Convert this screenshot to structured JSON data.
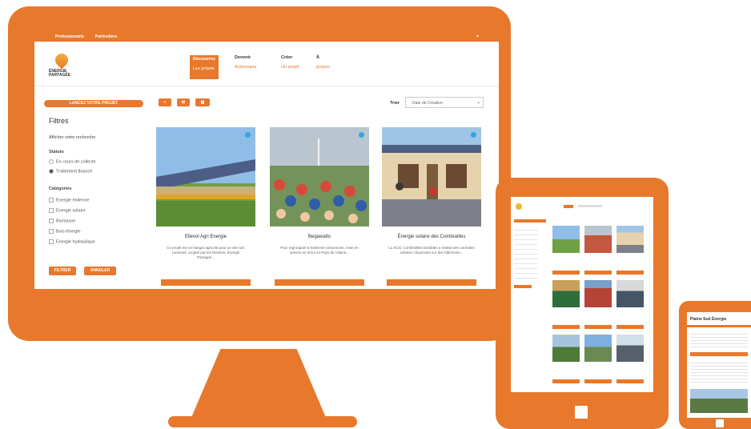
{
  "desktop": {
    "topbar": {
      "left_link_1": "Professionnels",
      "left_link_2": "Particuliers",
      "right_icon": "×"
    },
    "logo": {
      "line1": "ÉNERGIE",
      "line2": "PARTAGÉE"
    },
    "nav": [
      {
        "title": "Découvrez",
        "sub": "Les projets"
      },
      {
        "title": "Devenir",
        "sub": "Actionnaire"
      },
      {
        "title": "Créer",
        "sub": "Un projet"
      },
      {
        "title": "À",
        "sub": "propos"
      }
    ],
    "launch_button": "LANCEZ VOTRE PROJET",
    "view_buttons": [
      "≡",
      "⊞",
      "▦"
    ],
    "sort": {
      "label": "Trier",
      "value": "Date de Création"
    },
    "filters": {
      "title": "Filtres",
      "show_all": "Afficher votre recherche",
      "status_title": "Statuts",
      "statuses": [
        {
          "label": "En cours de collecte",
          "checked": false
        },
        {
          "label": "Traitement financé",
          "checked": true
        }
      ],
      "categories_title": "Catégories",
      "categories": [
        "Énergie éolienne",
        "Énergie solaire",
        "Biomasse",
        "Bois énergie",
        "Énergie hydraulique"
      ],
      "filter_button": "FILTRER",
      "reset_button": "ANNULER"
    },
    "cards": [
      {
        "title": "Ellevol Agri Energie",
        "desc": "Ce projet est un hangar agricole pour un site non connecté, projeté par les fermiers, Énergie Partagée..."
      },
      {
        "title": "Begawatts",
        "desc": "Parc regroupant 6 éoliennes citoyennes, mise en service en 2014 en Pays de Vilaine..."
      },
      {
        "title": "Énergie solaire des Combrailles",
        "desc": "La SCIC Combrailles Durables a réalisé des centrales solaires citoyennes sur des bâtiments..."
      }
    ]
  },
  "phone": {
    "title": "Plaine Sud Énergie"
  },
  "colors": {
    "accent": "#e8782c",
    "badge": "#2aa9e0"
  }
}
